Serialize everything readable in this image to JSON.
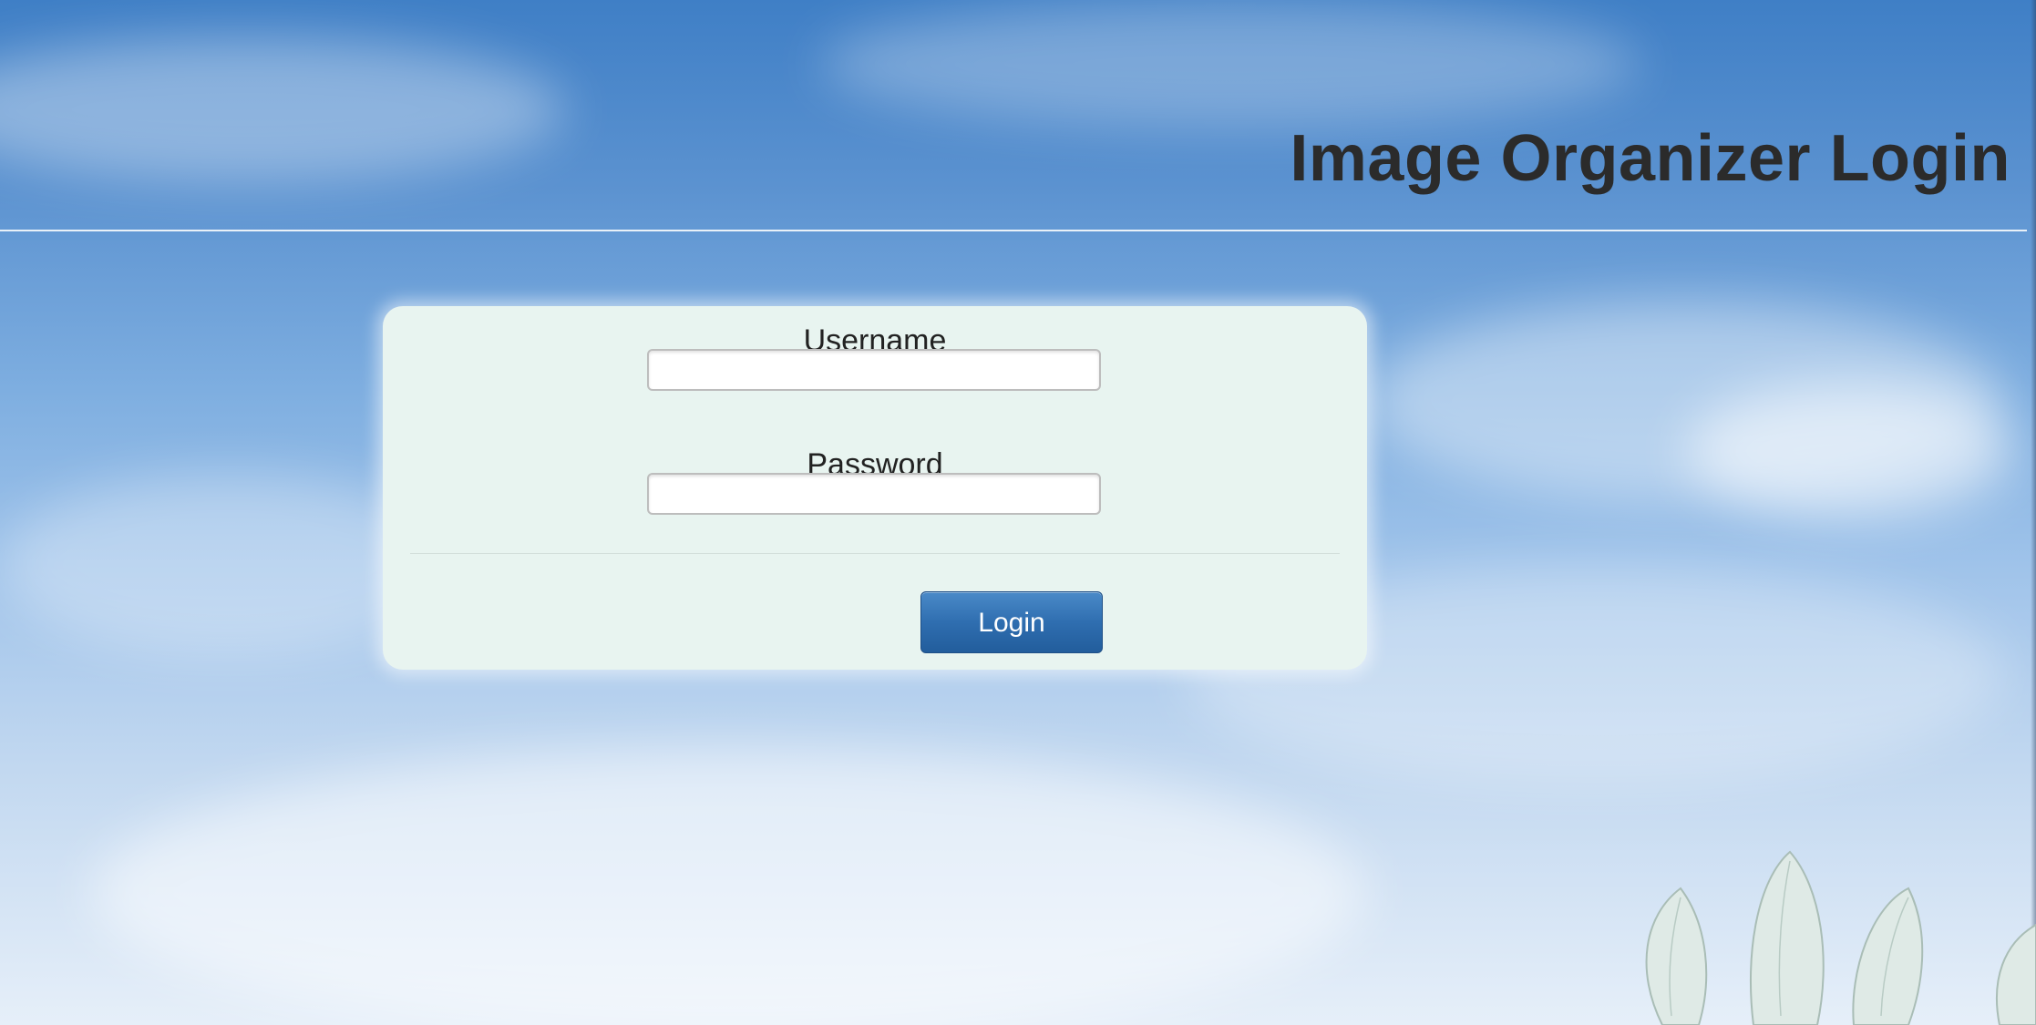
{
  "header": {
    "title": "Image Organizer Login"
  },
  "login_form": {
    "username_label": "Username",
    "username_value": "",
    "password_label": "Password",
    "password_value": "",
    "submit_label": "Login"
  },
  "colors": {
    "panel_background": "#e8f4f0",
    "button_primary": "#2f6eb0",
    "title_text": "#2b2b2b"
  },
  "icons": {
    "background_decoration": "flower-petals-icon"
  }
}
